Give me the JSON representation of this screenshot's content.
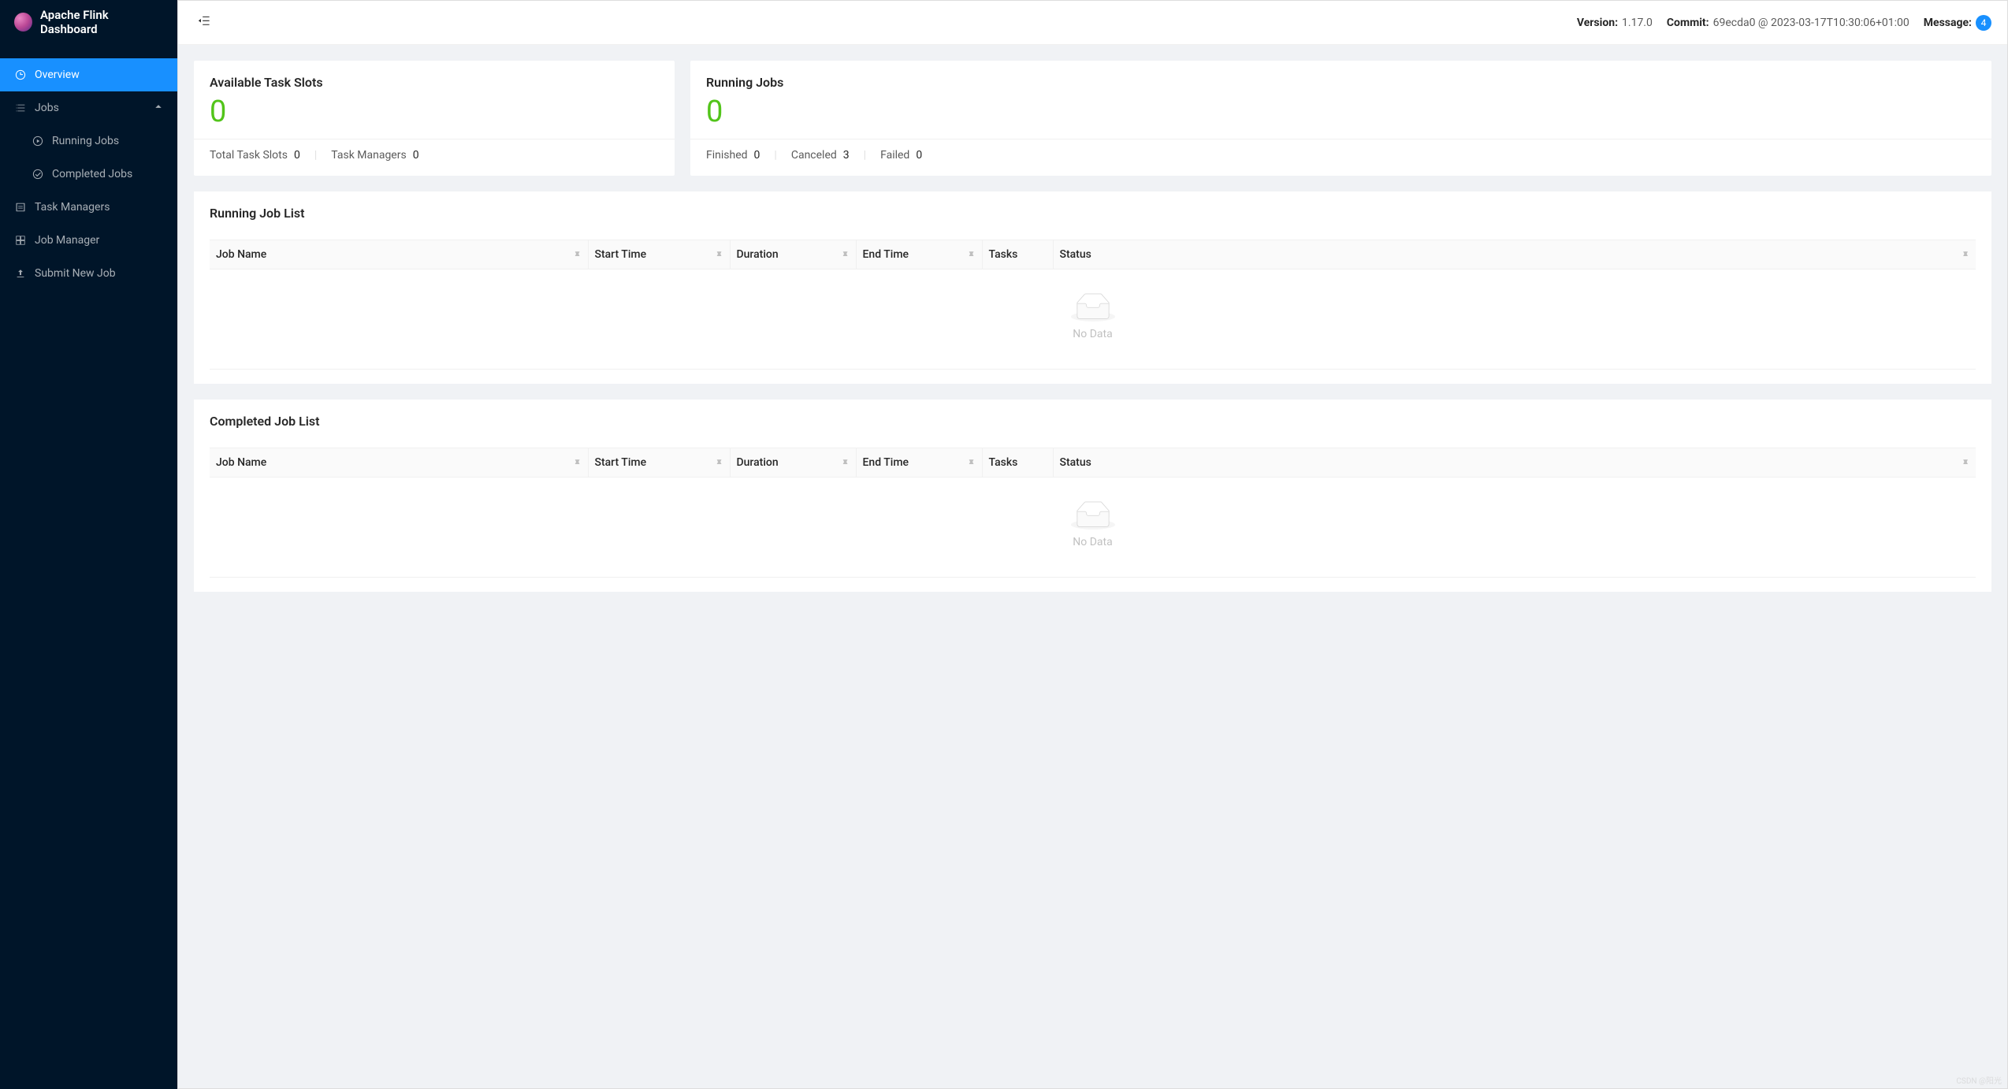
{
  "app": {
    "title": "Apache Flink Dashboard"
  },
  "sidebar": {
    "overview": "Overview",
    "jobs": "Jobs",
    "running_jobs": "Running Jobs",
    "completed_jobs": "Completed Jobs",
    "task_managers": "Task Managers",
    "job_manager": "Job Manager",
    "submit_new_job": "Submit New Job"
  },
  "header": {
    "version_label": "Version:",
    "version_value": "1.17.0",
    "commit_label": "Commit:",
    "commit_value": "69ecda0 @ 2023-03-17T10:30:06+01:00",
    "message_label": "Message:",
    "message_count": "4"
  },
  "stats": {
    "slots": {
      "title": "Available Task Slots",
      "value": "0",
      "total_label": "Total Task Slots",
      "total_value": "0",
      "tm_label": "Task Managers",
      "tm_value": "0"
    },
    "running": {
      "title": "Running Jobs",
      "value": "0",
      "finished_label": "Finished",
      "finished_value": "0",
      "canceled_label": "Canceled",
      "canceled_value": "3",
      "failed_label": "Failed",
      "failed_value": "0"
    }
  },
  "tables": {
    "running_title": "Running Job List",
    "completed_title": "Completed Job List",
    "columns": {
      "job_name": "Job Name",
      "start_time": "Start Time",
      "duration": "Duration",
      "end_time": "End Time",
      "tasks": "Tasks",
      "status": "Status"
    },
    "empty_text": "No Data"
  },
  "watermark": "CSDN @阳光"
}
